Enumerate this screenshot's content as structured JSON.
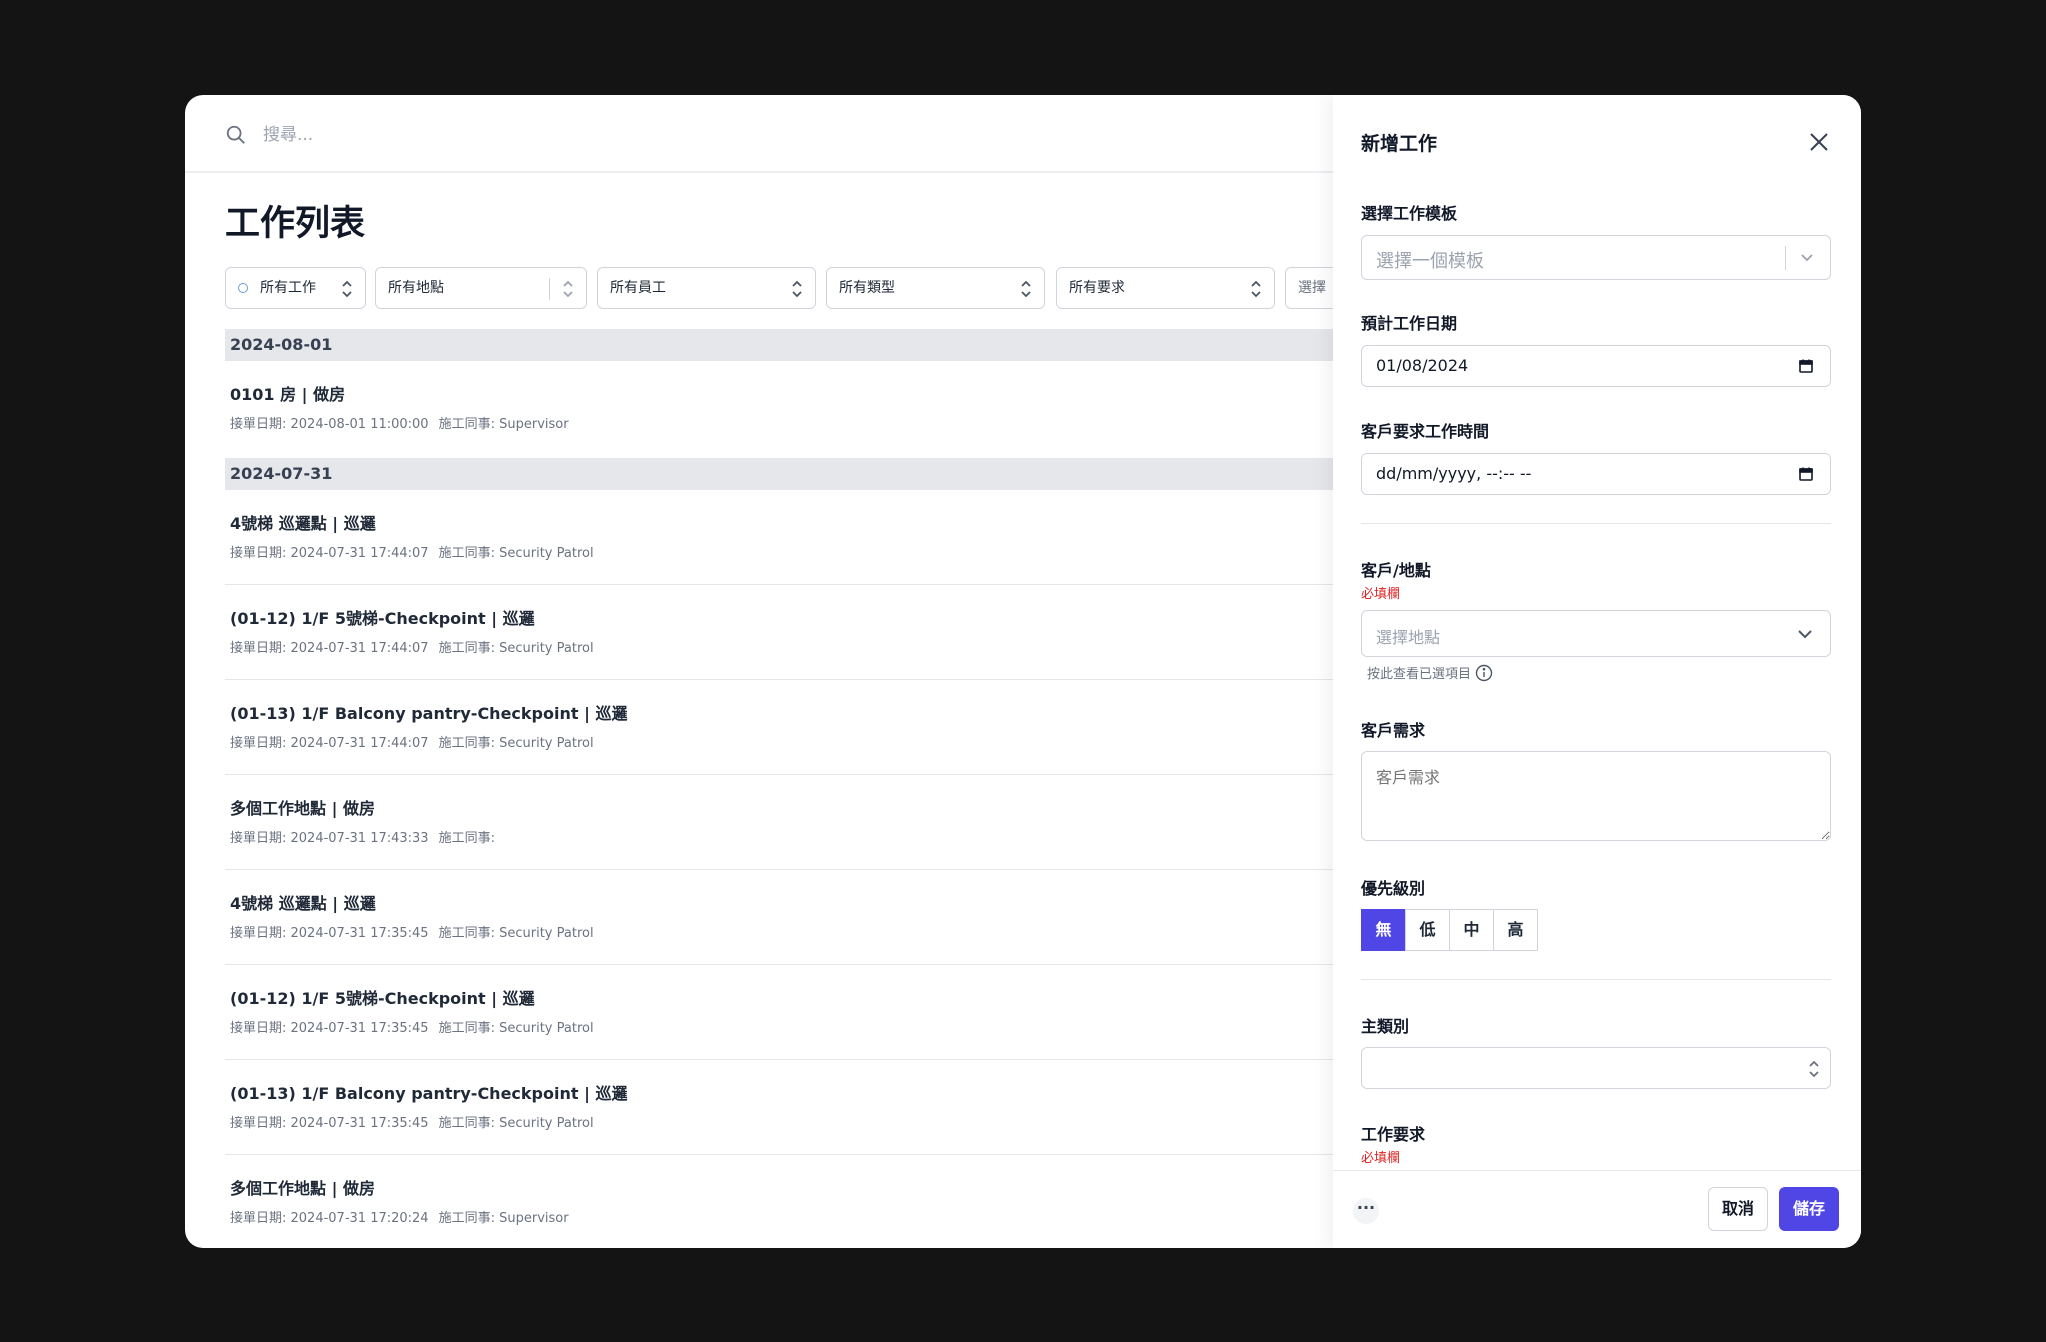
{
  "search": {
    "placeholder": "搜尋..."
  },
  "page_title": "工作列表",
  "filters": [
    {
      "label": "所有工作"
    },
    {
      "label": "所有地點"
    },
    {
      "label": "所有員工"
    },
    {
      "label": "所有類型"
    },
    {
      "label": "所有要求"
    },
    {
      "label": "選擇"
    }
  ],
  "groups": [
    {
      "date": "2024-08-01",
      "items": [
        {
          "title": "0101 房 | 做房",
          "received": "接單日期: 2024-08-01 11:00:00",
          "staff": "施工同事: Supervisor"
        }
      ]
    },
    {
      "date": "2024-07-31",
      "items": [
        {
          "title": "4號梯 巡邏點 | 巡邏",
          "received": "接單日期: 2024-07-31 17:44:07",
          "staff": "施工同事: Security Patrol"
        },
        {
          "title": "(01-12) 1/F 5號梯-Checkpoint | 巡邏",
          "received": "接單日期: 2024-07-31 17:44:07",
          "staff": "施工同事: Security Patrol"
        },
        {
          "title": "(01-13) 1/F Balcony pantry-Checkpoint | 巡邏",
          "received": "接單日期: 2024-07-31 17:44:07",
          "staff": "施工同事: Security Patrol"
        },
        {
          "title": "多個工作地點 | 做房",
          "received": "接單日期: 2024-07-31 17:43:33",
          "staff": "施工同事:"
        },
        {
          "title": "4號梯 巡邏點 | 巡邏",
          "received": "接單日期: 2024-07-31 17:35:45",
          "staff": "施工同事: Security Patrol"
        },
        {
          "title": "(01-12) 1/F 5號梯-Checkpoint | 巡邏",
          "received": "接單日期: 2024-07-31 17:35:45",
          "staff": "施工同事: Security Patrol"
        },
        {
          "title": "(01-13) 1/F Balcony pantry-Checkpoint | 巡邏",
          "received": "接單日期: 2024-07-31 17:35:45",
          "staff": "施工同事: Security Patrol"
        },
        {
          "title": "多個工作地點 | 做房",
          "received": "接單日期: 2024-07-31 17:20:24",
          "staff": "施工同事: Supervisor"
        }
      ]
    }
  ],
  "panel": {
    "title": "新增工作",
    "template_label": "選擇工作模板",
    "template_placeholder": "選擇一個模板",
    "date_label": "預計工作日期",
    "date_value": "01/08/2024",
    "time_label": "客戶要求工作時間",
    "time_value": "dd/mm/yyyy, --:-- --",
    "location_label": "客戶/地點",
    "required_text": "必填欄",
    "location_placeholder": "選擇地點",
    "location_hint": "按此查看已選項目",
    "request_label": "客戶需求",
    "request_placeholder": "客戶需求",
    "priority_label": "優先級別",
    "priorities": [
      "無",
      "低",
      "中",
      "高"
    ],
    "category_label": "主類別",
    "work_req_label": "工作要求",
    "cancel_label": "取消",
    "save_label": "儲存",
    "more_label": "···"
  },
  "colors": {
    "accent": "#4f46e5",
    "required": "#dc2626",
    "date_header_bg": "#e5e7eb",
    "backdrop": "#141414"
  }
}
